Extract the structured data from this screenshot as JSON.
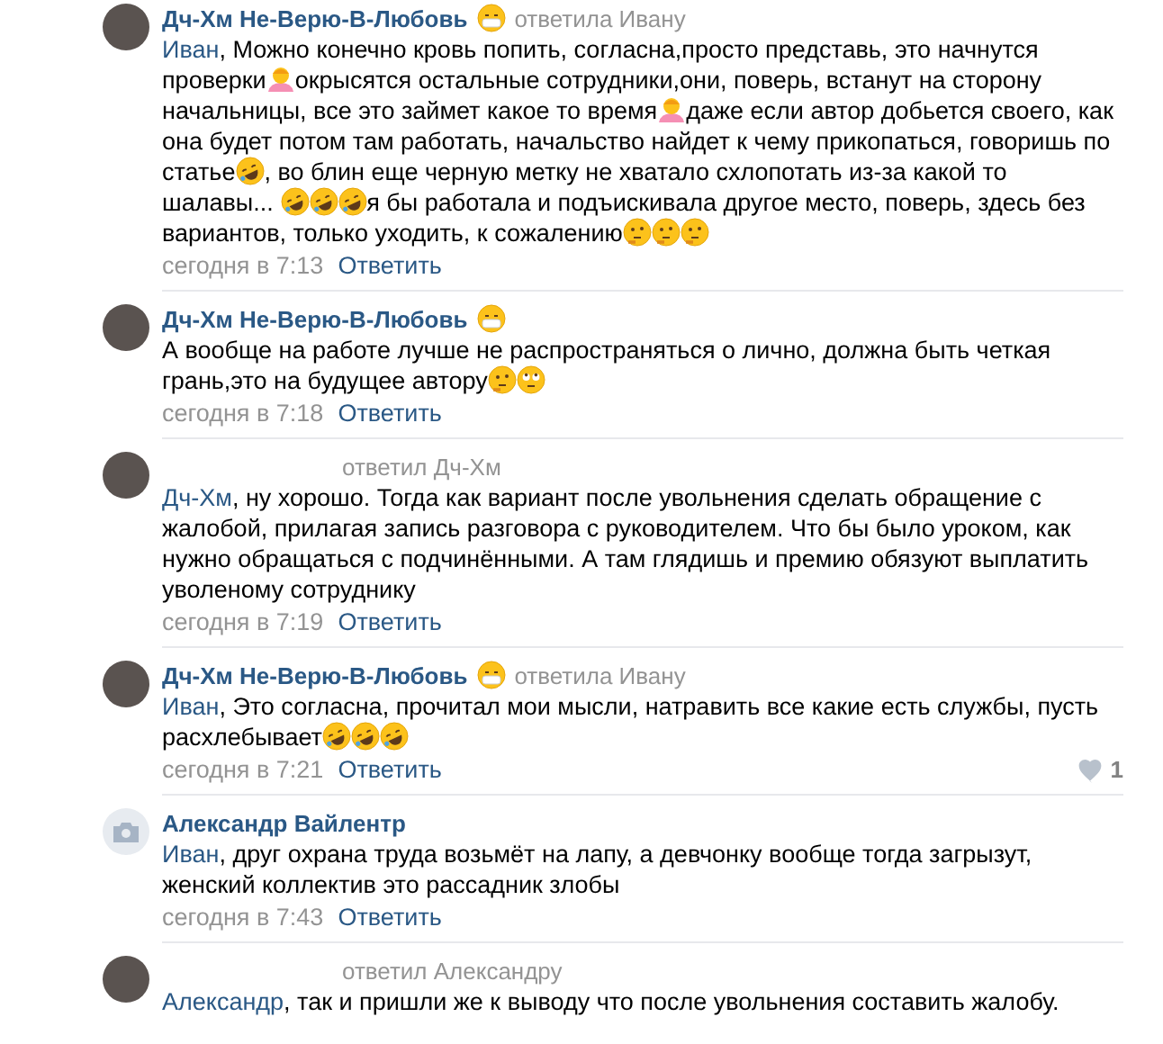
{
  "comments": [
    {
      "author": "Дч-Хм Не-Верю-В-Любовь",
      "author_emoji": true,
      "reply_to": "ответила Ивану",
      "body": [
        {
          "kind": "mention",
          "text": "Иван"
        },
        {
          "kind": "text",
          "text": ", Можно конечно кровь попить, согласна,просто представь, это начнутся проверки"
        },
        {
          "kind": "shrug"
        },
        {
          "kind": "text",
          "text": "окрысятся остальные сотрудники,они, поверь, встанут на сторону начальницы, все это займет какое то время"
        },
        {
          "kind": "shrug"
        },
        {
          "kind": "text",
          "text": "даже если автор добьется своего, как она будет потом там работать, начальство найдет к чему прикопаться, говоришь по статье"
        },
        {
          "kind": "rofl"
        },
        {
          "kind": "text",
          "text": ", во блин еще черную метку не хватало схлопотать из-за какой то шалавы... "
        },
        {
          "kind": "rofl"
        },
        {
          "kind": "rofl"
        },
        {
          "kind": "rofl"
        },
        {
          "kind": "text",
          "text": "я бы работала и подъискивала другое место, поверь, здесь без вариантов, только уходить, к сожалению"
        },
        {
          "kind": "thinking"
        },
        {
          "kind": "thinking"
        },
        {
          "kind": "thinking"
        }
      ],
      "time": "сегодня в 7:13",
      "reply": "Ответить"
    },
    {
      "author": "Дч-Хм Не-Верю-В-Любовь",
      "author_emoji": true,
      "body": [
        {
          "kind": "text",
          "text": "А вообще на работе лучше не распространяться о лично, должна быть четкая грань,это на будущее автору"
        },
        {
          "kind": "thinking"
        },
        {
          "kind": "eyeroll"
        }
      ],
      "time": "сегодня в 7:18",
      "reply": "Ответить"
    },
    {
      "author_emoji": false,
      "reply_to": "ответил Дч-Хм",
      "body": [
        {
          "kind": "mention",
          "text": "Дч-Хм"
        },
        {
          "kind": "text",
          "text": ", ну хорошо. Тогда как вариант после увольнения сделать обращение с жалобой, прилагая запись разговора с руководителем. Что бы было уроком, как нужно обращаться с подчинёнными. А там глядишь и премию обязуют выплатить уволеному сотруднику"
        }
      ],
      "time": "сегодня в 7:19",
      "reply": "Ответить"
    },
    {
      "author": "Дч-Хм Не-Верю-В-Любовь",
      "author_emoji": true,
      "reply_to": "ответила Ивану",
      "body": [
        {
          "kind": "mention",
          "text": "Иван"
        },
        {
          "kind": "text",
          "text": ", Это согласна, прочитал мои мысли, натравить все какие есть службы, пусть расхлебывает"
        },
        {
          "kind": "rofl"
        },
        {
          "kind": "rofl"
        },
        {
          "kind": "rofl"
        }
      ],
      "time": "сегодня в 7:21",
      "reply": "Ответить",
      "likes": "1"
    },
    {
      "avatar_photo": false,
      "author": "Александр Вайлентр",
      "author_emoji": false,
      "body": [
        {
          "kind": "mention",
          "text": "Иван"
        },
        {
          "kind": "text",
          "text": ", друг охрана труда возьмёт на лапу, а девчонку вообще тогда загрызут, женский коллектив это рассадник злобы"
        }
      ],
      "time": "сегодня в 7:43",
      "reply": "Ответить"
    },
    {
      "author_emoji": false,
      "reply_to": "ответил Александру",
      "body": [
        {
          "kind": "mention",
          "text": "Александр"
        },
        {
          "kind": "text",
          "text": ", так и пришли же к выводу что после увольнения составить жалобу."
        }
      ]
    }
  ]
}
